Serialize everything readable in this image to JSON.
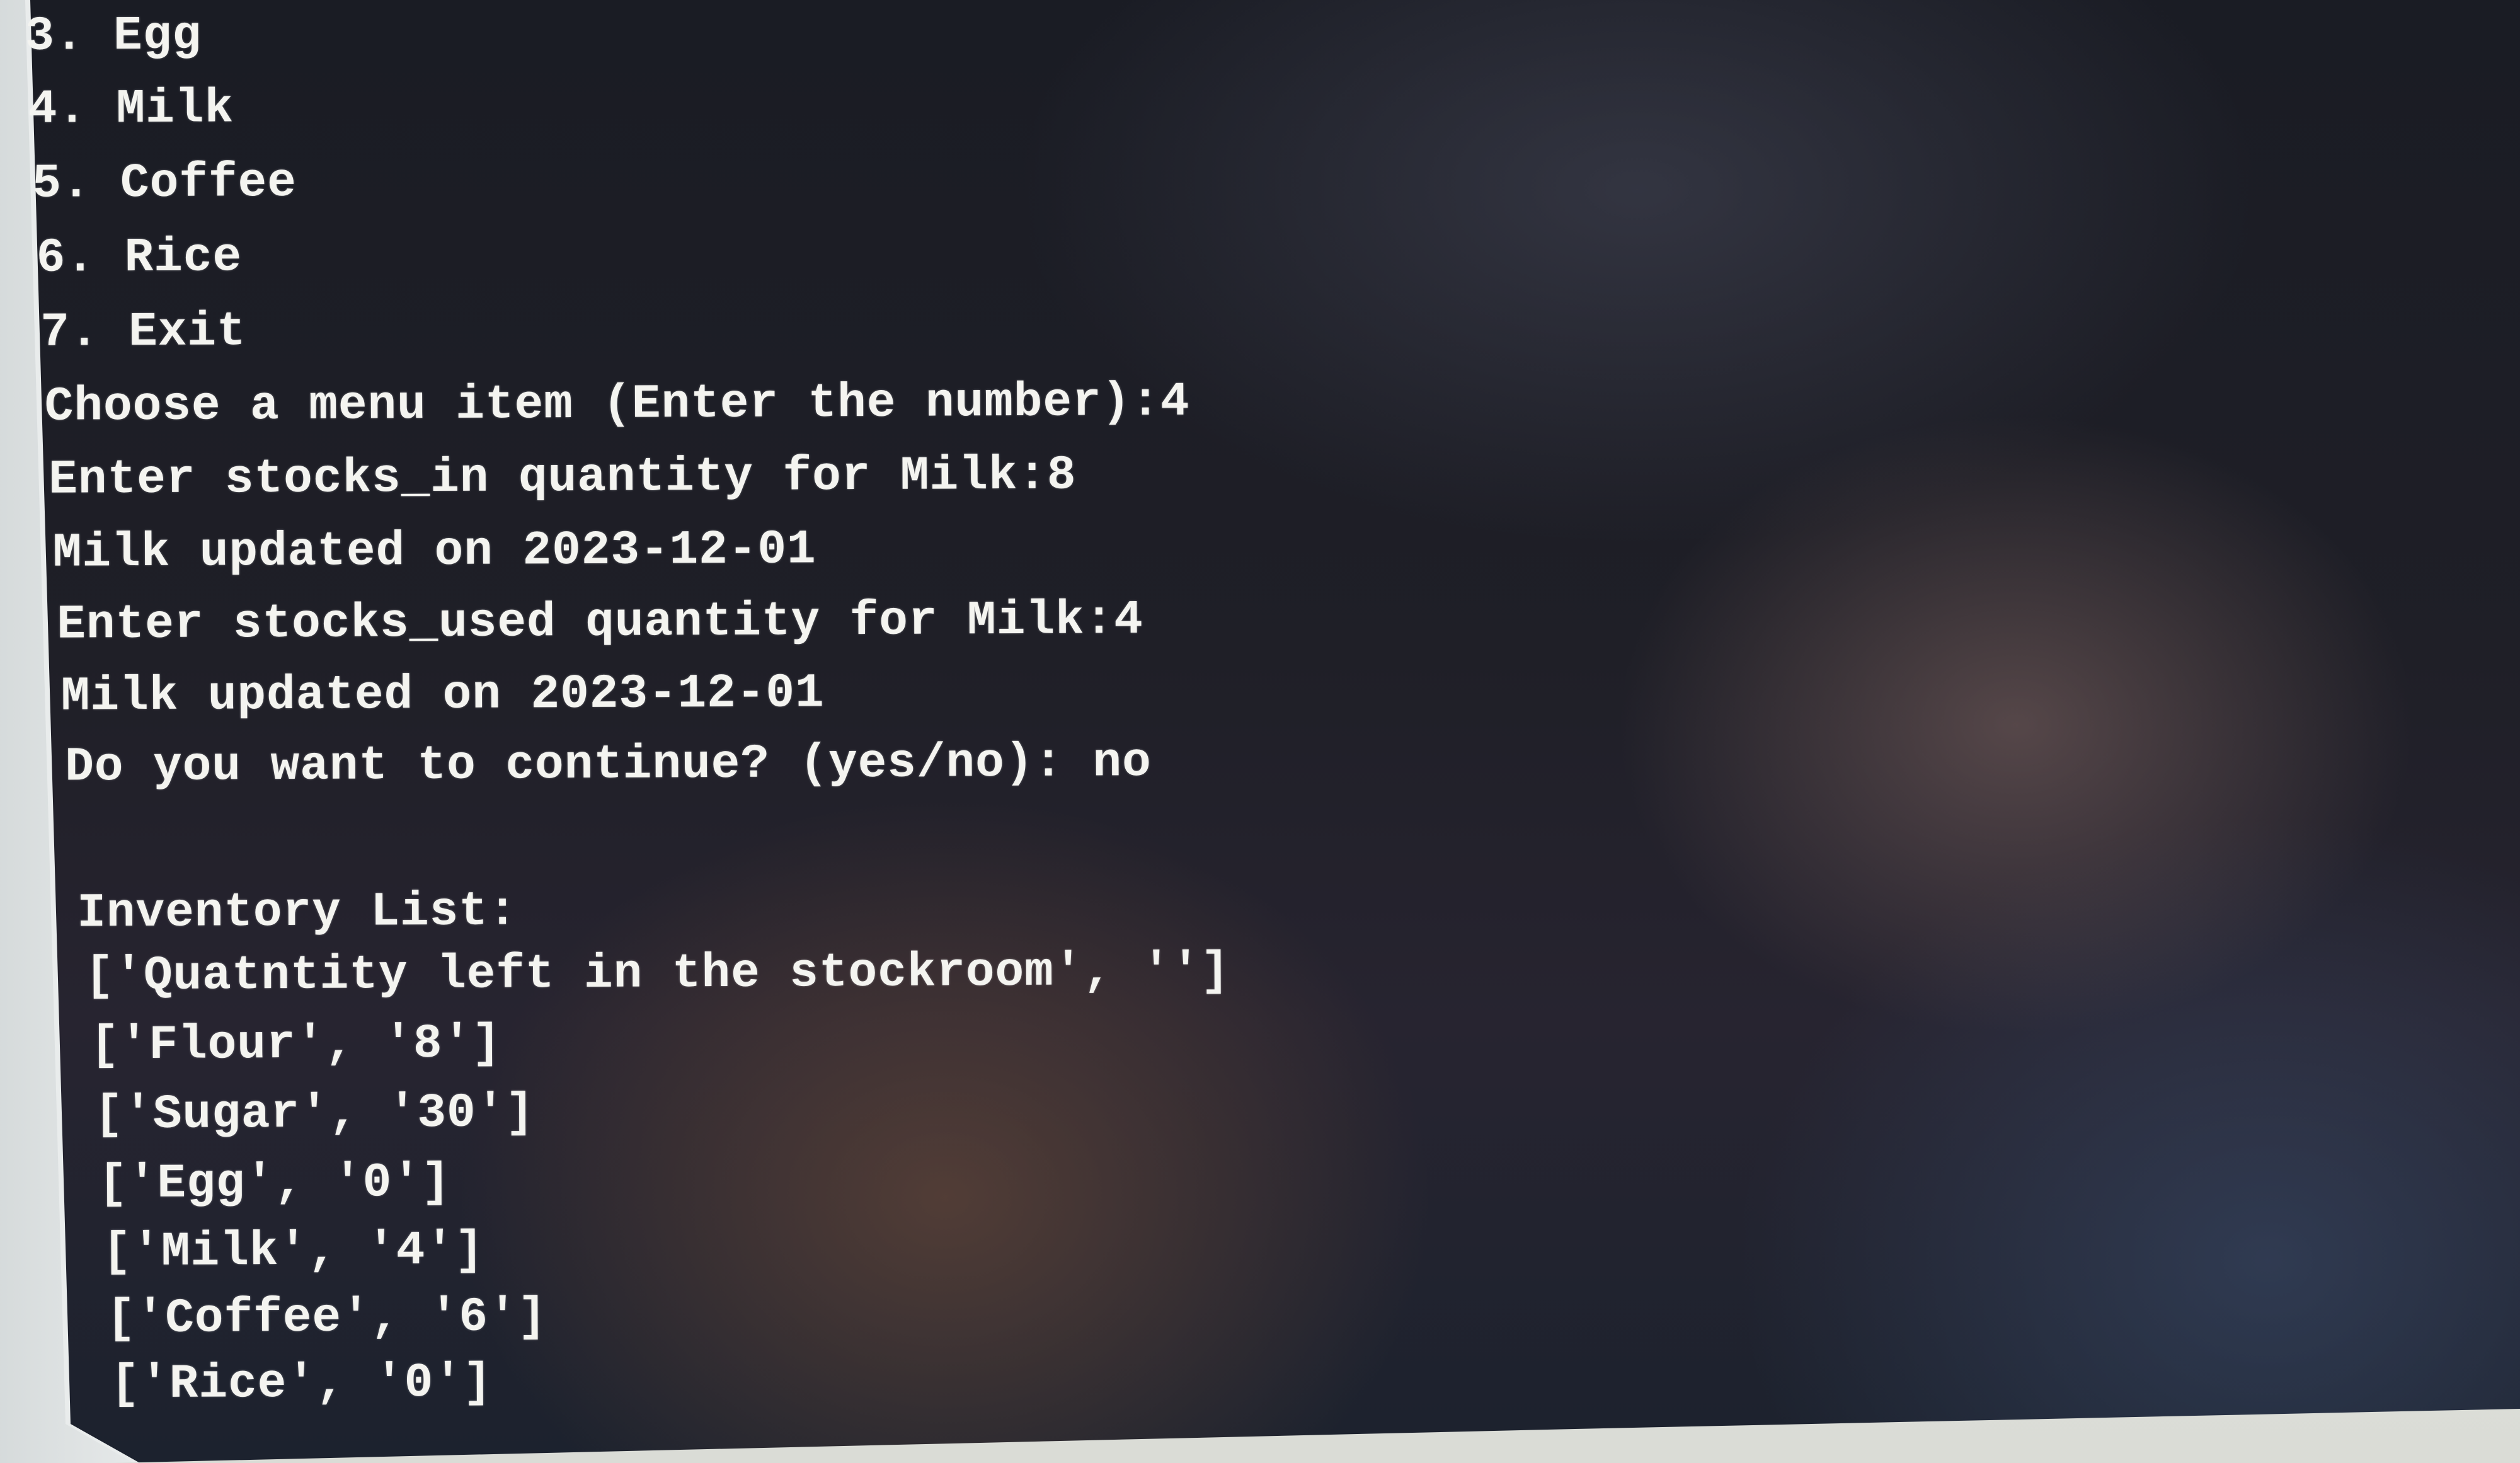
{
  "terminal": {
    "lines": [
      "3. Egg",
      "4. Milk",
      "5. Coffee",
      "6. Rice",
      "7. Exit",
      "Choose a menu item (Enter the number):4",
      "Enter stocks_in quantity for Milk:8",
      "Milk updated on 2023-12-01",
      "Enter stocks_used quantity for Milk:4",
      "Milk updated on 2023-12-01",
      "Do you want to continue? (yes/no): no",
      "",
      "Inventory List:",
      "['Quatntity left in the stockroom', '']",
      "['Flour', '8']",
      "['Sugar', '30']",
      "['Egg', '0']",
      "['Milk', '4']",
      "['Coffee', '6']",
      "['Rice', '0']"
    ]
  }
}
